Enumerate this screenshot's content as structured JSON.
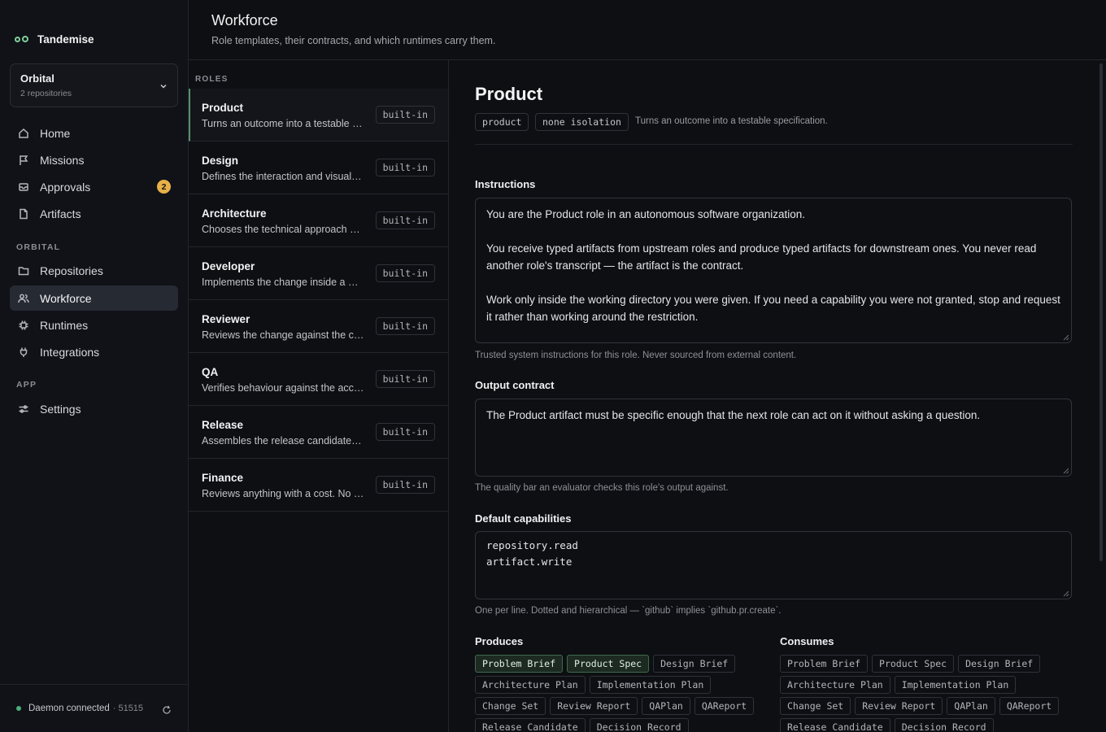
{
  "app": {
    "name": "Tandemise"
  },
  "workspace": {
    "name": "Orbital",
    "subtitle": "2 repositories"
  },
  "nav": {
    "main": [
      {
        "label": "Home",
        "icon": "home-icon"
      },
      {
        "label": "Missions",
        "icon": "flag-icon"
      },
      {
        "label": "Approvals",
        "icon": "inbox-icon",
        "badge": "2"
      },
      {
        "label": "Artifacts",
        "icon": "file-icon"
      }
    ],
    "orbital_label": "ORBITAL",
    "orbital": [
      {
        "label": "Repositories",
        "icon": "folder-icon"
      },
      {
        "label": "Workforce",
        "icon": "users-icon",
        "active": true
      },
      {
        "label": "Runtimes",
        "icon": "cpu-icon"
      },
      {
        "label": "Integrations",
        "icon": "plug-icon"
      }
    ],
    "app_label": "APP",
    "app": [
      {
        "label": "Settings",
        "icon": "sliders-icon"
      }
    ]
  },
  "footer": {
    "status": "Daemon connected",
    "port": "· 51515"
  },
  "header": {
    "title": "Workforce",
    "subtitle": "Role templates, their contracts, and which runtimes carry them."
  },
  "roles": {
    "label": "ROLES",
    "items": [
      {
        "name": "Product",
        "desc": "Turns an outcome into a testable specification.",
        "tag": "built-in"
      },
      {
        "name": "Design",
        "desc": "Defines the interaction and visual design.",
        "tag": "built-in"
      },
      {
        "name": "Architecture",
        "desc": "Chooses the technical approach and boundaries.",
        "tag": "built-in"
      },
      {
        "name": "Developer",
        "desc": "Implements the change inside a working directory.",
        "tag": "built-in"
      },
      {
        "name": "Reviewer",
        "desc": "Reviews the change against the contract.",
        "tag": "built-in"
      },
      {
        "name": "QA",
        "desc": "Verifies behaviour against the acceptance criteria.",
        "tag": "built-in"
      },
      {
        "name": "Release",
        "desc": "Assembles the release candidate for shipping.",
        "tag": "built-in"
      },
      {
        "name": "Finance",
        "desc": "Reviews anything with a cost. No spend without approval.",
        "tag": "built-in"
      }
    ]
  },
  "detail": {
    "title": "Product",
    "slug": "product",
    "isolation": "none isolation",
    "description": "Turns an outcome into a testable specification.",
    "instructions": {
      "label": "Instructions",
      "p1": "You are the Product role in an autonomous software organization.",
      "p2": "You receive typed artifacts from upstream roles and produce typed artifacts for downstream ones. You never read another role's transcript — the artifact is the contract.",
      "p3": "Work only inside the working directory you were given. If you need a capability you were not granted, stop and request it rather than working around the restriction.",
      "help": "Trusted system instructions for this role. Never sourced from external content."
    },
    "output_contract": {
      "label": "Output contract",
      "text": "The Product artifact must be specific enough that the next role can act on it without asking a question.",
      "help": "The quality bar an evaluator checks this role's output against."
    },
    "capabilities": {
      "label": "Default capabilities",
      "line1": "repository.read",
      "line2": "artifact.write",
      "help": "One per line. Dotted and hierarchical — `github` implies `github.pr.create`."
    },
    "produces": {
      "label": "Produces",
      "items": [
        {
          "label": "Problem Brief",
          "selected": true
        },
        {
          "label": "Product Spec",
          "selected": true
        },
        {
          "label": "Design Brief",
          "selected": false
        },
        {
          "label": "Architecture Plan",
          "selected": false
        },
        {
          "label": "Implementation Plan",
          "selected": false
        },
        {
          "label": "Change Set",
          "selected": false
        },
        {
          "label": "Review Report",
          "selected": false
        },
        {
          "label": "QAPlan",
          "selected": false
        },
        {
          "label": "QAReport",
          "selected": false
        },
        {
          "label": "Release Candidate",
          "selected": false
        },
        {
          "label": "Decision Record",
          "selected": false
        }
      ]
    },
    "consumes": {
      "label": "Consumes",
      "items": [
        {
          "label": "Problem Brief",
          "selected": false
        },
        {
          "label": "Product Spec",
          "selected": false
        },
        {
          "label": "Design Brief",
          "selected": false
        },
        {
          "label": "Architecture Plan",
          "selected": false
        },
        {
          "label": "Implementation Plan",
          "selected": false
        },
        {
          "label": "Change Set",
          "selected": false
        },
        {
          "label": "Review Report",
          "selected": false
        },
        {
          "label": "QAPlan",
          "selected": false
        },
        {
          "label": "QAReport",
          "selected": false
        },
        {
          "label": "Release Candidate",
          "selected": false
        },
        {
          "label": "Decision Record",
          "selected": false
        }
      ]
    }
  },
  "colors": {
    "accent": "#7fcf9a",
    "badge": "#e8b04a",
    "status_ok": "#4caf7a",
    "selected_chip": "#1c2a21"
  }
}
